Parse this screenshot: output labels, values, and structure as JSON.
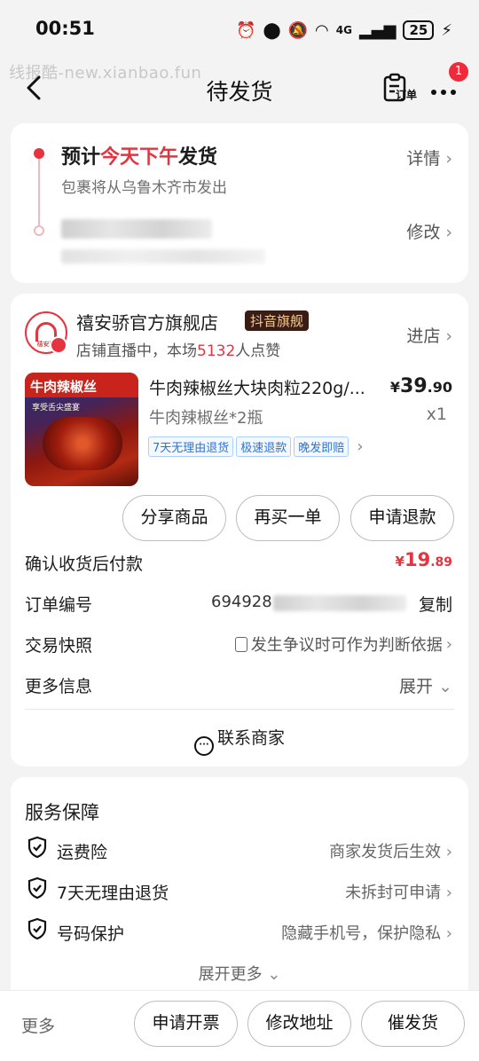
{
  "status_bar": {
    "time": "00:51",
    "battery": "25",
    "network": "4G"
  },
  "watermark": "线报酷-new.xianbao.fun",
  "nav": {
    "title": "待发货",
    "order_label": "订单",
    "badge_count": "1"
  },
  "delivery": {
    "title_prefix": "预计",
    "title_highlight": "今天下午",
    "title_suffix": "发货",
    "subtitle": "包裹将从乌鲁木齐市发出",
    "detail_link": "详情",
    "modify_link": "修改"
  },
  "shop": {
    "logo_text": "禧安骄",
    "name": "禧安骄官方旗舰店",
    "badge": "抖音旗舰",
    "live_prefix": "店铺直播中，本场",
    "live_count": "5132",
    "live_suffix": "人点赞",
    "enter_link": "进店"
  },
  "product": {
    "image_label": "牛肉辣椒丝",
    "image_sub": "享受舌尖盛宴",
    "title": "牛肉辣椒丝大块肉粒220g/...",
    "price_symbol": "¥",
    "price_int": "39",
    "price_dec": ".90",
    "spec": "牛肉辣椒丝*2瓶",
    "quantity": "x1",
    "tags": [
      "7天无理由退货",
      "极速退款",
      "晚发即赔"
    ]
  },
  "actions": {
    "share": "分享商品",
    "rebuy": "再买一单",
    "refund": "申请退款"
  },
  "payment": {
    "label": "确认收货后付款",
    "symbol": "¥",
    "int": "19",
    "dec": ".89"
  },
  "order": {
    "number_label": "订单编号",
    "number_visible": "694928",
    "copy": "复制",
    "snapshot_label": "交易快照",
    "snapshot_value": "发生争议时可作为判断依据",
    "more_label": "更多信息",
    "expand": "展开",
    "contact": "联系商家"
  },
  "service": {
    "title": "服务保障",
    "items": [
      {
        "label": "运费险",
        "value": "商家发货后生效"
      },
      {
        "label": "7天无理由退货",
        "value": "未拆封可申请"
      },
      {
        "label": "号码保护",
        "value": "隐藏手机号，保护隐私"
      }
    ],
    "expand_more": "展开更多"
  },
  "bottom": {
    "more": "更多",
    "invoice": "申请开票",
    "address": "修改地址",
    "urge": "催发货"
  },
  "colors": {
    "accent_red": "#e5343f",
    "tag_blue": "#2a74d9",
    "background": "#f3f3f4"
  }
}
